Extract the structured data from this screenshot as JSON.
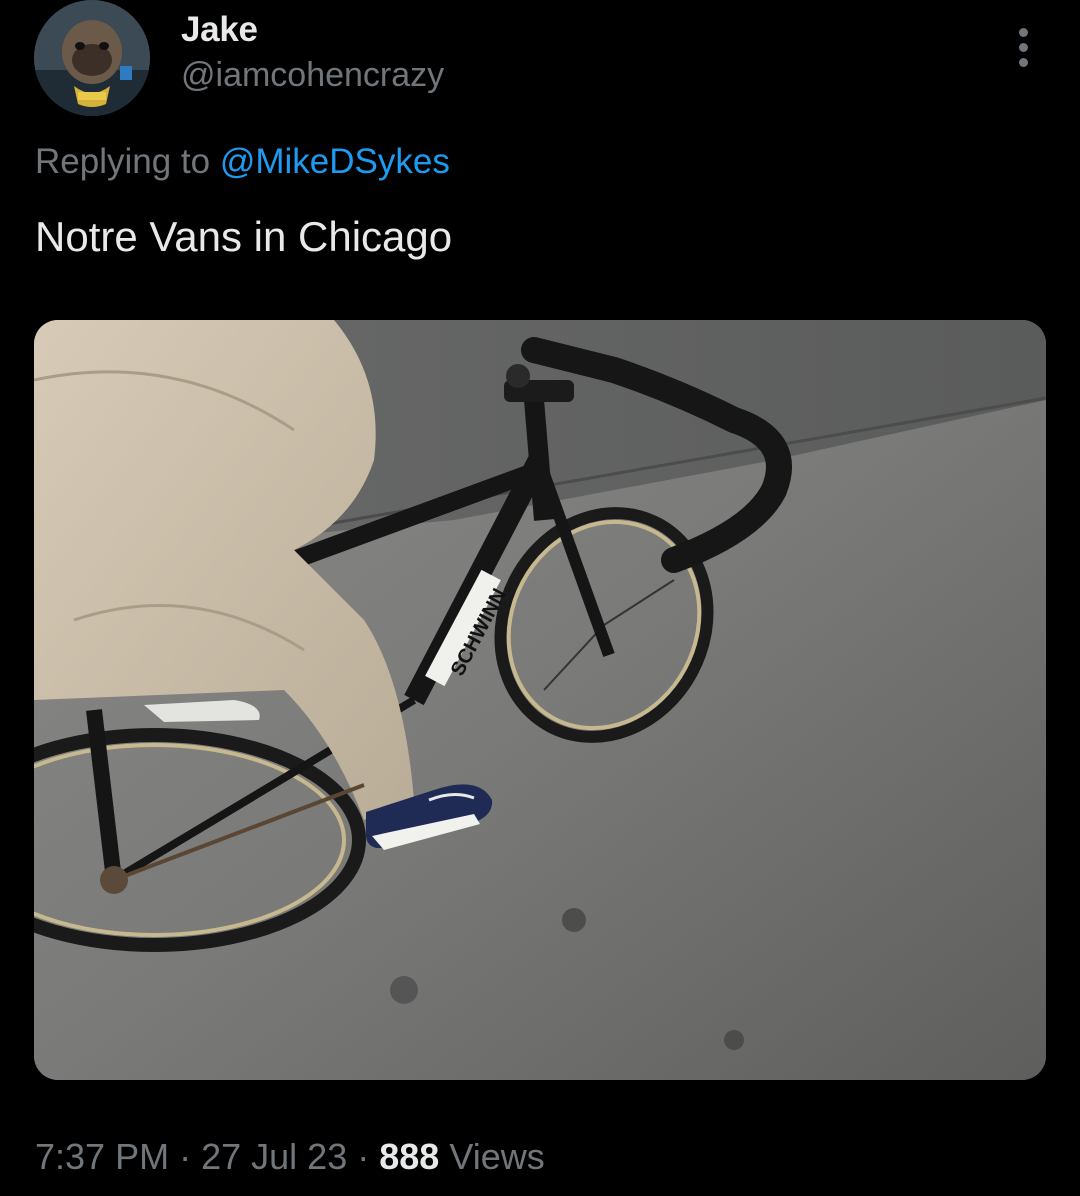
{
  "author": {
    "display_name": "Jake",
    "handle": "@iamcohencrazy",
    "avatar_icon": "bulldog-avatar"
  },
  "reply": {
    "prefix": "Replying to",
    "mention": "@MikeDSykes"
  },
  "tweet": {
    "text": "Notre Vans in Chicago"
  },
  "media": {
    "description_icon": "photo-bike-rider",
    "frame_brand": "SCHWINN"
  },
  "meta": {
    "time": "7:37 PM",
    "separator": "·",
    "date": "27 Jul 23",
    "views_count": "888",
    "views_label": "Views"
  },
  "colors": {
    "background": "#000000",
    "primary_text": "#e7e9ea",
    "secondary_text": "#71767b",
    "link": "#1d9bf0"
  }
}
